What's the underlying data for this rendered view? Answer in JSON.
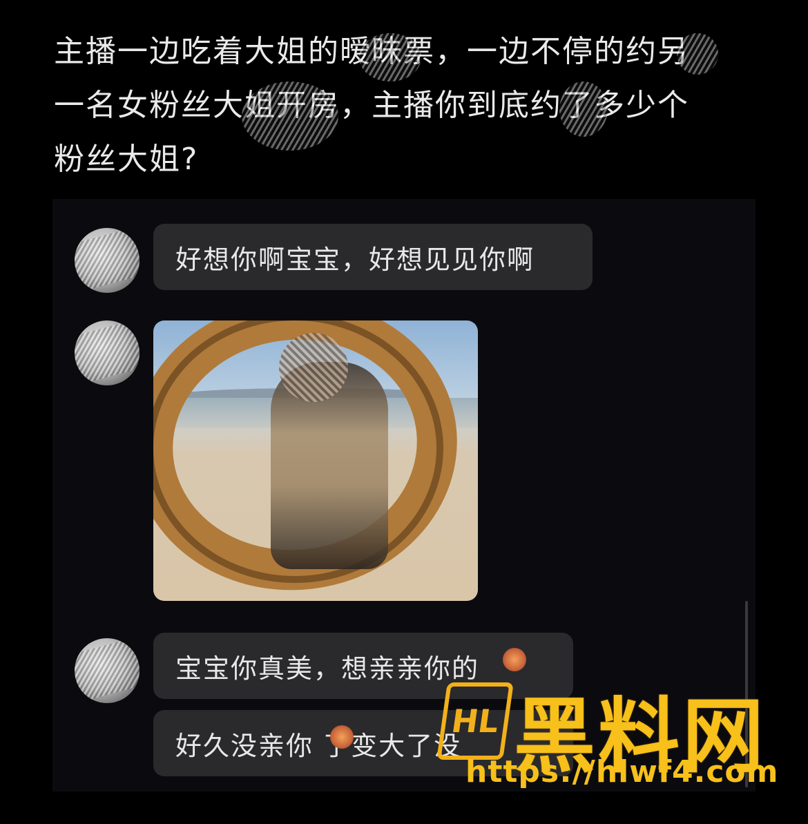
{
  "caption": {
    "line1": "主播一边吃着大姐的暧昧票，一边不停的约另",
    "line2": "一名女粉丝大姐开房，主播你到底约了多少个",
    "line3": "粉丝大姐?"
  },
  "messages": [
    {
      "text": "好想你啊宝宝，好想见见你啊"
    },
    {
      "text": "宝宝你真美，想亲亲你的"
    },
    {
      "text": "好久没亲你   了变大了没"
    }
  ],
  "photo_message": {
    "alt": "photo"
  },
  "watermark": {
    "logo": "HL",
    "title": "黑料网",
    "url": "https://hlwf4.com"
  },
  "colors": {
    "background": "#000000",
    "bubble": "#2a2a2d",
    "text": "#e8e8e8",
    "watermark": "#f7c01a"
  }
}
